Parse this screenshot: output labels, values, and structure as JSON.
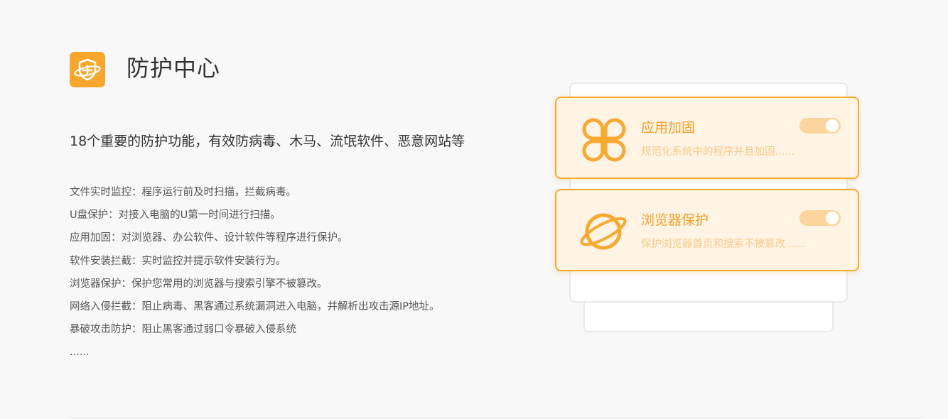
{
  "header": {
    "title": "防护中心",
    "icon": "shield-plus-icon",
    "icon_color": "#f8a72c"
  },
  "intro": {
    "subtitle": "18个重要的防护功能，有效防病毒、木马、流氓软件、恶意网站等"
  },
  "features": [
    "文件实时监控：程序运行前及时扫描，拦截病毒。",
    "U盘保护：对接入电脑的U第一时间进行扫描。",
    "应用加固：对浏览器、办公软件、设计软件等程序进行保护。",
    "软件安装拦截：实时监控并提示软件安装行为。",
    "浏览器保护：保护您常用的浏览器与搜索引擎不被篡改。",
    "网络入侵拦截：阻止病毒、黑客通过系统漏洞进入电脑，并解析出攻击源IP地址。",
    "暴破攻击防护：阻止黑客通过弱口令暴破入侵系统",
    "......"
  ],
  "cards": [
    {
      "title": "应用加固",
      "description": "规范化系统中的程序并且加固......",
      "icon": "app-grid-icon",
      "enabled": true
    },
    {
      "title": "浏览器保护",
      "description": "保护浏览器首页和搜索不被篡改......",
      "icon": "planet-icon",
      "enabled": true
    }
  ],
  "colors": {
    "accent": "#f7a931",
    "card_background": "#fff3e4",
    "toggle_on": "#fbd59d"
  }
}
